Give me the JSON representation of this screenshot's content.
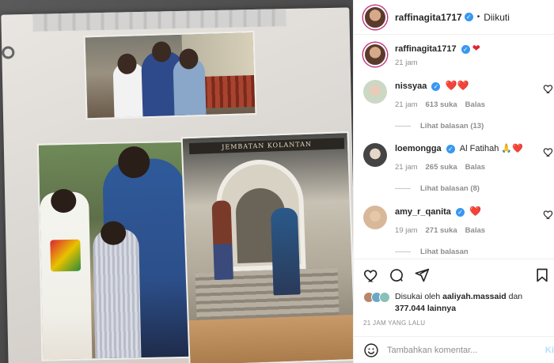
{
  "post": {
    "author": "raffinagita1717",
    "follow_status": "Diikuti",
    "separator": "•",
    "caption_emoji": "❤",
    "caption_time": "21 jam"
  },
  "comments": [
    {
      "user": "nissyaa",
      "text": "❤️❤️",
      "time": "21 jam",
      "likes": "613 suka",
      "reply_label": "Balas",
      "view_replies": "Lihat balasan (13)",
      "avatar_color": "#cbd8c4"
    },
    {
      "user": "loemongga",
      "text": "Al Fatihah 🙏❤️",
      "time": "21 jam",
      "likes": "265 suka",
      "reply_label": "Balas",
      "view_replies": "Lihat balasan (8)",
      "avatar_color": "#444444"
    },
    {
      "user": "amy_r_qanita",
      "text": "❤️",
      "time": "19 jam",
      "likes": "271 suka",
      "reply_label": "Balas",
      "view_replies": "Lihat balasan",
      "avatar_color": "#d8b89a"
    }
  ],
  "likes": {
    "prefix": "Disukai oleh ",
    "user": "aaliyah.massaid",
    "middle": " dan ",
    "count": "377.044 lainnya"
  },
  "timestamp": "21 JAM YANG LALU",
  "comment_input": {
    "placeholder": "Tambahkan komentar...",
    "post_label": "Kirim"
  },
  "photo_sign": "JEMBATAN KOLANTAN",
  "colors": {
    "verified": "#3897f0",
    "heart": "#e0242f",
    "muted": "#8e8e8e",
    "post_button": "#b2dffc"
  }
}
